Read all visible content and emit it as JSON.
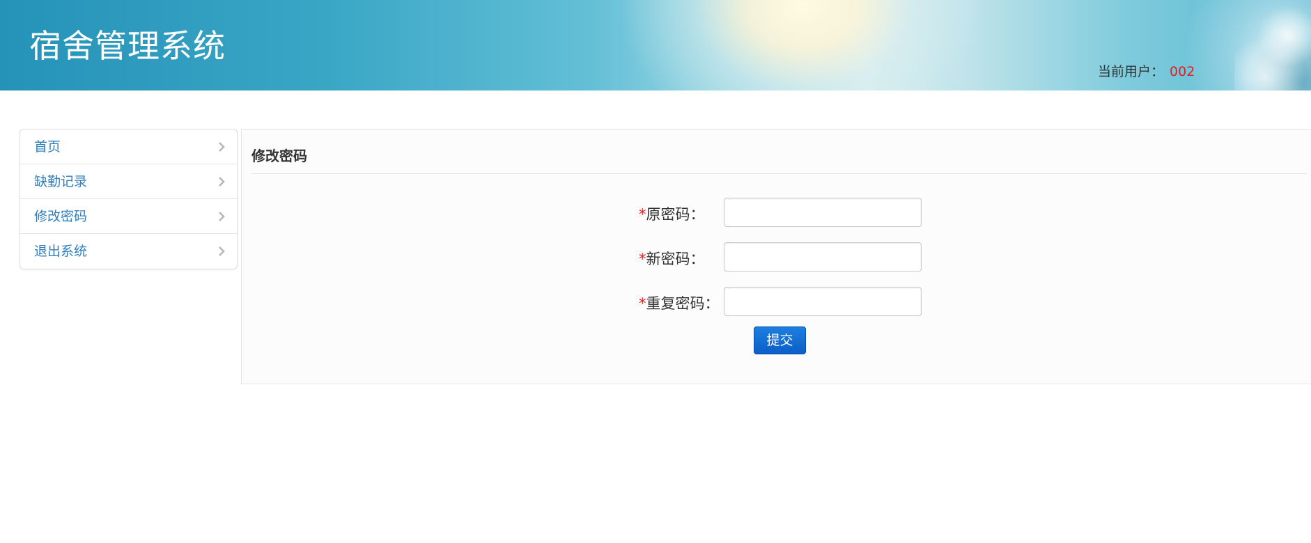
{
  "header": {
    "title": "宿舍管理系统",
    "current_user_label": "当前用户：",
    "current_user_value": "002"
  },
  "sidebar": {
    "items": [
      {
        "label": "首页",
        "icon": "chevron-right-icon"
      },
      {
        "label": "缺勤记录",
        "icon": "chevron-right-icon"
      },
      {
        "label": "修改密码",
        "icon": "chevron-right-icon"
      },
      {
        "label": "退出系统",
        "icon": "chevron-right-icon"
      }
    ]
  },
  "panel": {
    "title": "修改密码",
    "fields": [
      {
        "required_mark": "*",
        "label": "原密码：",
        "value": ""
      },
      {
        "required_mark": "*",
        "label": "新密码：",
        "value": ""
      },
      {
        "required_mark": "*",
        "label": "重复密码：",
        "value": ""
      }
    ],
    "submit_label": "提交"
  },
  "colors": {
    "link": "#2f7fbf",
    "required": "#e0201e",
    "button": "#1169d4"
  }
}
